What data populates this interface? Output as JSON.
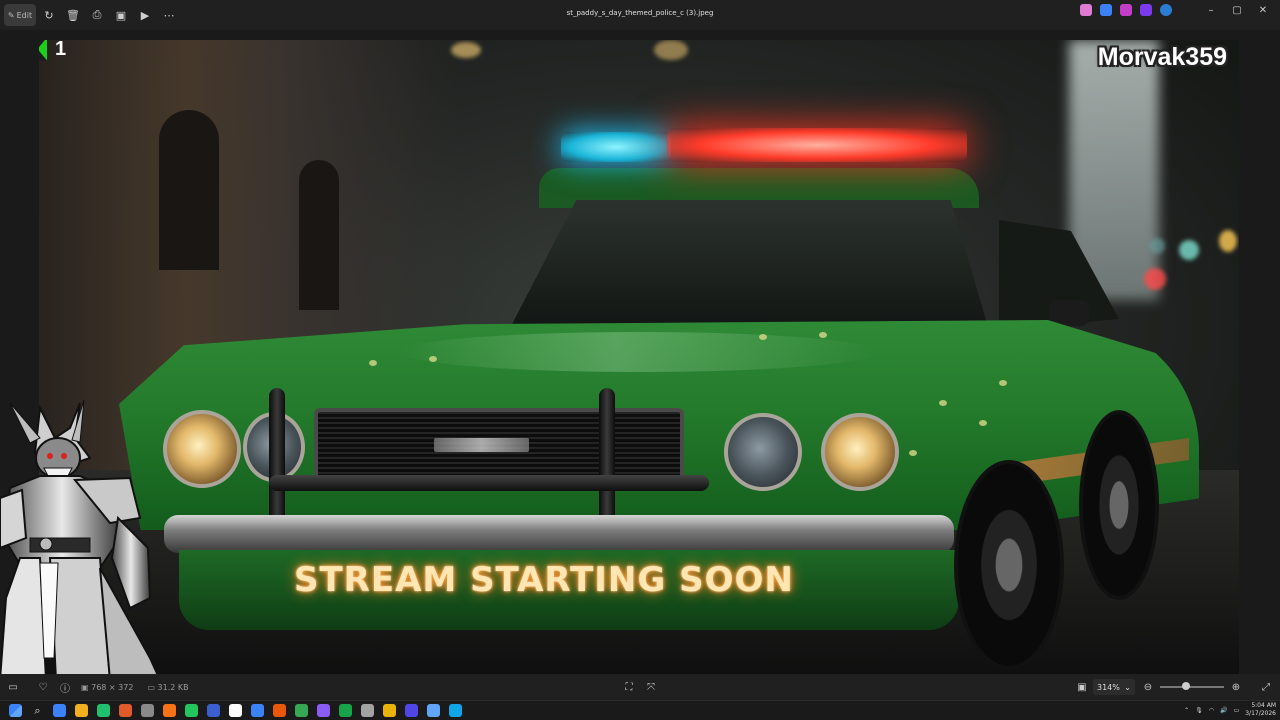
{
  "window": {
    "title": "st_paddy_s_day_themed_police_c (3).jpeg",
    "edit_label": "Edit"
  },
  "toolbar_left_icons": [
    "edit-icon",
    "rotate-icon",
    "delete-icon",
    "print-icon",
    "edit-image-icon",
    "slideshow-icon",
    "more-icon"
  ],
  "toolbar_right_apps": [
    {
      "name": "copilot-icon",
      "color": "#e07bd2"
    },
    {
      "name": "edit-app-icon",
      "color": "#3b82f6"
    },
    {
      "name": "designer-icon",
      "color": "#c23ec8"
    },
    {
      "name": "clipchamp-icon",
      "color": "#7c3aed"
    },
    {
      "name": "onedrive-icon",
      "color": "#2b7cd3"
    }
  ],
  "window_controls": {
    "minimize": "–",
    "maximize": "▢",
    "close": "✕"
  },
  "image": {
    "kick_followers": "1",
    "channel_name": "Morvak359",
    "sign_text": "STREAM STARTING SOON",
    "accent_colors": {
      "kick_green": "#1bd01b",
      "car_green": "#237a2b",
      "siren_red": "#ff3b2a",
      "siren_blue": "#19b4d8"
    }
  },
  "statusbar": {
    "dimensions": "768 × 372",
    "file_size": "31.2 KB",
    "zoom": "314%",
    "zoom_level_fraction": 0.4
  },
  "taskbar": {
    "time": "5:04 AM",
    "date": "3/17/2026",
    "app_colors": [
      "#3b82f6",
      "#f2b01e",
      "#21c06e",
      "#e05a2c",
      "#8a8a8a",
      "#f97316",
      "#22c55e",
      "#3b5fcf",
      "#ffffff",
      "#3b82f6",
      "#ea580c",
      "#34a853",
      "#8b5cf6",
      "#16a34a",
      "#a3a3a3",
      "#eab308",
      "#4f46e5",
      "#60a5fa",
      "#0ea5e9"
    ]
  }
}
